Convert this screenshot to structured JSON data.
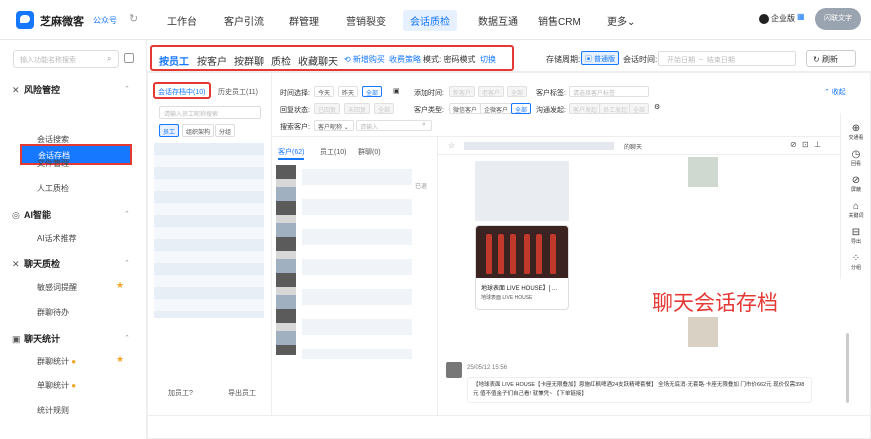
{
  "app": {
    "brand": "芝麻微客",
    "account": "公众号",
    "sync_icon": "sync-icon"
  },
  "nav": [
    "工作台",
    "客户引流",
    "群管理",
    "营销裂变",
    "会话质检",
    "数据互通",
    "销售CRM",
    "更多⌄"
  ],
  "topright": {
    "enterprise": "企业版",
    "avatar": "闪联文字"
  },
  "sidebar": {
    "search_placeholder": "输入功能名称搜索",
    "sections": [
      {
        "title": "风险管控",
        "icon": "✕",
        "items": [
          "会话存档",
          "会话搜索",
          "文件管理",
          "人工质检"
        ]
      },
      {
        "title": "AI智能",
        "icon": "◎",
        "items": [
          "AI话术推荐"
        ]
      },
      {
        "title": "聊天质检",
        "icon": "✕",
        "items": [
          "敏感词提醒",
          "群聊待办"
        ]
      },
      {
        "title": "聊天统计",
        "icon": "▣",
        "items": [
          "群聊统计",
          "单聊统计",
          "统计规则"
        ]
      }
    ]
  },
  "toolbar": {
    "tabs": [
      "按员工",
      "按客户",
      "按群聊",
      "质检",
      "收藏聊天"
    ],
    "link_new": "⟲ 新增购买",
    "link_fee": "收费策略",
    "mode_label": "模式: 密码模式",
    "mode_switch": "切换",
    "store_label": "存储周期:",
    "store_value": "普通版",
    "session_label": "会话时间:",
    "date_start": "开始日期",
    "date_sep": "~",
    "date_end": "结束日期",
    "refresh": "刷新"
  },
  "col1": {
    "tab_active": "会话存档中(10)",
    "tab_history": "历史员工(11)",
    "search_placeholder": "请输入员工昵称搜索",
    "chips": [
      "员工",
      "组织架构",
      "分组"
    ],
    "footer_add": "加员工?",
    "footer_export": "导出员工"
  },
  "filters": {
    "time_label": "时间选择:",
    "time_opts": [
      "今天",
      "昨天",
      "全部"
    ],
    "add_time_label": "添加时间:",
    "add_opts": [
      "新客户",
      "老客户",
      "全部"
    ],
    "tag_label": "客户标签:",
    "tag_placeholder": "请选择客户标签",
    "reply_label": "回复状态:",
    "reply_opts": [
      "已回复",
      "未回复",
      "全部"
    ],
    "type_label": "客户类型:",
    "type_opts": [
      "微信客户",
      "企微客户",
      "全部"
    ],
    "flow_label": "沟通发起:",
    "flow_opts": [
      "客户发起",
      "员工发起",
      "全部"
    ],
    "search_label": "搜索客户:",
    "search_type": "客户昵称 ⌄",
    "search_placeholder": "请输入",
    "collapse": "⌃ 收起"
  },
  "col2": {
    "tabs": [
      "客户(62)",
      "员工(10)",
      "群聊(0)"
    ],
    "exited": "已退"
  },
  "panel": {
    "header_suffix": "的聊天",
    "card_title": "地球表面 LIVE HOUSE】[ ...",
    "card_sub": "地球表面 LIVE HOUSE",
    "overlay": "聊天会话存档",
    "msg_meta": "25/05/12 15:56",
    "msg_body": "【地球表面 LIVE HOUSE【卡座无限叠加】恩施红枫啤酒24支跃精啤套餐】 全场无底消·无套路·卡座无限叠加 门市价662元 现价仅需398元 值不值金子们自己看! 就兼凭~ 【下单链接】"
  },
  "rail": [
    {
      "icon": "⊕",
      "label": "交通看"
    },
    {
      "icon": "◷",
      "label": "回看"
    },
    {
      "icon": "⊘",
      "label": "屏蔽"
    },
    {
      "icon": "⌂",
      "label": "关键词"
    },
    {
      "icon": "⊟",
      "label": "导出"
    },
    {
      "icon": "⁘",
      "label": "分组"
    }
  ]
}
